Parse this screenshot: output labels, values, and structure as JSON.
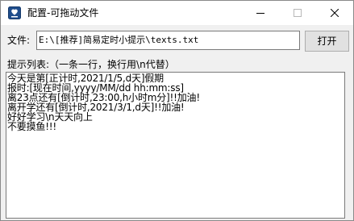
{
  "window": {
    "title": "配置-可拖动文件"
  },
  "file": {
    "label": "文件:",
    "path": "E:\\[推荐]简易定时小提示\\texts.txt",
    "open_label": "打开"
  },
  "list": {
    "label": "提示列表:（一条一行，换行用\\n代替）",
    "lines": [
      "今天是第[正计时,2021/1/5,d天]假期",
      "报时:[现在时间,yyyy/MM/dd hh:mm:ss]",
      "离23点还有[倒计时,23:00,h小时m分]!!加油!",
      "离开学还有[倒计时,2021/3/1,d天]!!加油!",
      "好好学习\\n天天向上",
      "不要摸鱼!!!"
    ]
  }
}
